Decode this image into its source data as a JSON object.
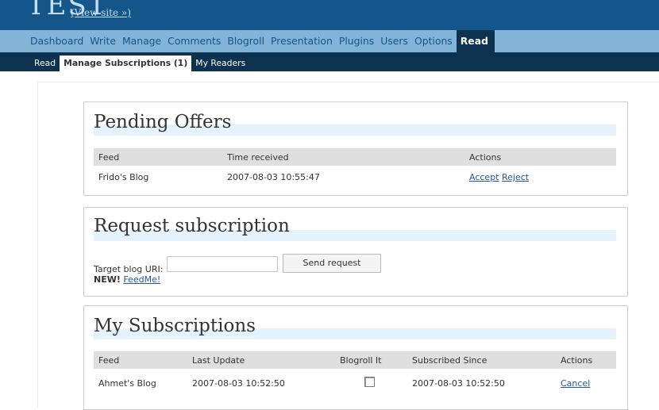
{
  "header": {
    "site_title": "TEST",
    "view_site": "(View site »)"
  },
  "menu": [
    "Dashboard",
    "Write",
    "Manage",
    "Comments",
    "Blogroll",
    "Presentation",
    "Plugins",
    "Users",
    "Options"
  ],
  "menu_current": "Read",
  "submenu": {
    "read": "Read",
    "manage": "Manage Subscriptions (1)",
    "readers": "My Readers"
  },
  "pending": {
    "title": "Pending Offers",
    "columns": [
      "Feed",
      "Time received",
      "Actions"
    ],
    "rows": [
      {
        "feed": "Frido's Blog",
        "time": "2007-08-03 10:55:47",
        "accept": "Accept",
        "reject": "Reject"
      }
    ]
  },
  "request": {
    "title": "Request subscription",
    "label": "Target blog URI:",
    "input_value": "",
    "button": "Send request",
    "new_label": "NEW!",
    "feedme": "FeedMe!"
  },
  "subscriptions": {
    "title": "My Subscriptions",
    "columns": [
      "Feed",
      "Last Update",
      "Blogroll It",
      "Subscribed Since",
      "Actions"
    ],
    "rows": [
      {
        "feed": "Ahmet's Blog",
        "last_update": "2007-08-03 10:52:50",
        "blogroll": false,
        "since": "2007-08-03 10:52:50",
        "action": "Cancel"
      }
    ]
  },
  "colors": {
    "header": "#14568a",
    "menu": "#83b4d8",
    "submenu": "#0d324f",
    "title_text": "#c3def1",
    "link": "#2157a6",
    "rule": "#e5f3ff"
  }
}
